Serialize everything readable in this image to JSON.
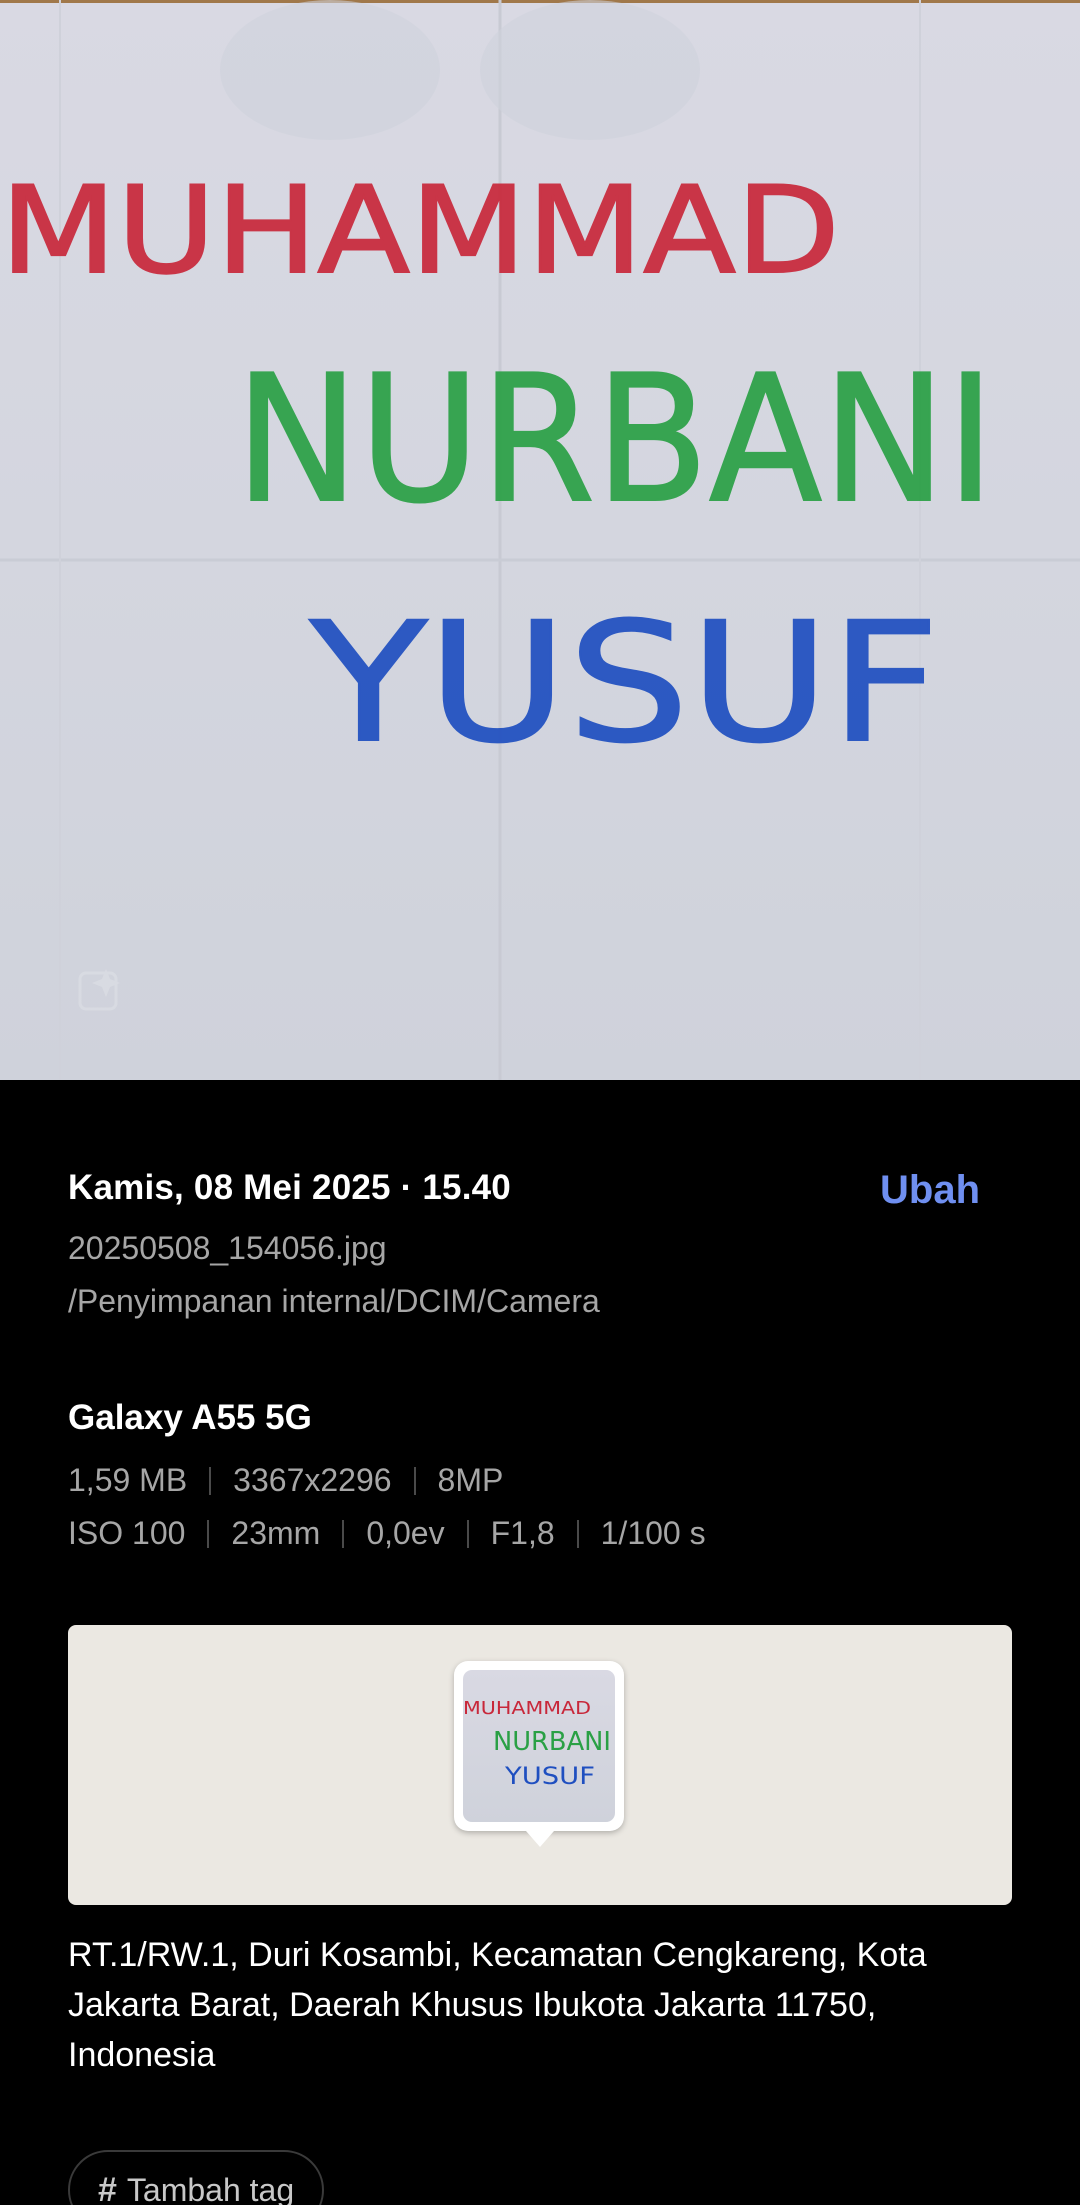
{
  "photo": {
    "handwriting_lines": [
      "MUHAMMAD",
      "NURBANI",
      "YUSUF"
    ],
    "colors": {
      "line1": "#c8283a",
      "line2": "#2aa045",
      "line3": "#1f4fc0",
      "paper": "#d6d8e1"
    }
  },
  "details": {
    "date_time": "Kamis, 08 Mei 2025 · 15.40",
    "edit_label": "Ubah",
    "file_name": "20250508_154056.jpg",
    "file_path": "/Penyimpanan internal/DCIM/Camera"
  },
  "camera": {
    "device": "Galaxy A55 5G",
    "row1": [
      "1,59 MB",
      "3367x2296",
      "8MP"
    ],
    "row2": [
      "ISO 100",
      "23mm",
      "0,0ev",
      "F1,8",
      "1/100 s"
    ]
  },
  "location": {
    "address": "RT.1/RW.1, Duri Kosambi, Kecamatan Cengkareng, Kota Jakarta Barat, Daerah Khusus Ibukota Jakarta 11750, Indonesia"
  },
  "tags": {
    "hash_symbol": "#",
    "add_label": "Tambah tag"
  },
  "theme": {
    "accent": "#6f8ff0",
    "background": "#000000",
    "secondary_text": "#a6a6a6",
    "map_background": "#ebe8e2"
  }
}
